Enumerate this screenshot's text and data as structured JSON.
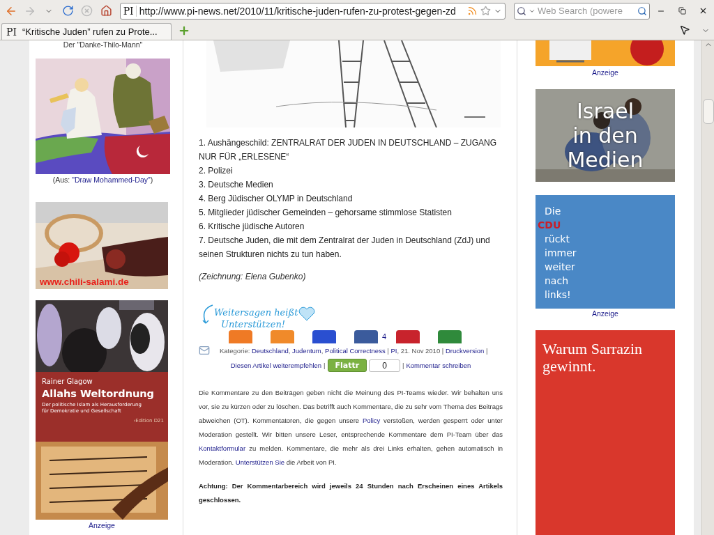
{
  "browser": {
    "url": "http://www.pi-news.net/2010/11/kritische-juden-rufen-zu-protest-gegen-zd",
    "url_favicon": "PI",
    "search_placeholder": "Web Search (powere",
    "tabs": [
      {
        "favicon": "PI",
        "title": "“Kritische Juden” rufen zu Prote...",
        "selected": true
      }
    ]
  },
  "left_column": {
    "top_caption": "Der \"Danke-Thilo-Mann\"",
    "cartoon_caption": {
      "prefix": "(Aus: ",
      "link": "\"Draw Mohammed-Day\"",
      "suffix": ")"
    },
    "salami_ad": "www.chili-salami.de",
    "book": {
      "author": "Rainer Glagow",
      "title": "Allahs Weltordnung",
      "subtitle": "Der politische Islam als Herausforderung für Demokratie und Gesellschaft",
      "publisher": "›Edition D21"
    },
    "ad_label": "Anzeige"
  },
  "article": {
    "list": [
      "1. Aushängeschild: ZENTRALRAT DER JUDEN IN DEUTSCHLAND – ZUGANG NUR FÜR „ERLESENE“",
      "2. Polizei",
      "3. Deutsche Medien",
      "4. Berg Jüdischer OLYMP in Deutschland",
      "5. Mitglieder jüdischer Gemeinden – gehorsame stimmlose Statisten",
      "6. Kritische jüdische Autoren",
      "7. Deutsche Juden, die mit dem Zentralrat der Juden in Deutschland (ZdJ) und seinen Strukturen nichts zu tun haben."
    ],
    "credit": "(Zeichnung: Elena Gubenko)",
    "slogan": [
      "Weitersagen heißt",
      "Unterstützen!"
    ],
    "share_count": "4",
    "meta": [
      {
        "text": "Kategorie: "
      },
      {
        "text": "Deutschland",
        "link": true
      },
      {
        "text": ", "
      },
      {
        "text": "Judentum",
        "link": true
      },
      {
        "text": ", "
      },
      {
        "text": "Political Correctness",
        "link": true
      },
      {
        "text": " | "
      },
      {
        "text": "PI",
        "link": true
      },
      {
        "text": ", 21. Nov 2010 | "
      },
      {
        "text": "Druckversion",
        "link": true
      },
      {
        "text": " |"
      }
    ],
    "recommend": "Diesen Artikel weiterempfehlen",
    "separators": [
      "|",
      "|"
    ],
    "flattr": {
      "label": "Flattr",
      "count": "0"
    },
    "comment_link": "Kommentar schreiben",
    "disclaimer": [
      {
        "text": "Die Kommentare zu den Beiträgen geben nicht die Meinung des PI-Teams wieder. Wir behalten uns vor, sie zu kürzen oder zu löschen. Das betrifft auch Kommentare, die zu sehr vom Thema des Beitrags abweichen (OT). Kommentatoren, die gegen unsere "
      },
      {
        "text": "Policy",
        "link": true
      },
      {
        "text": " verstoßen, werden gesperrt oder unter Moderation gestellt. Wir bitten unsere Leser, entsprechende Kommentare dem PI-Team über das "
      },
      {
        "text": "Kontaktformular",
        "link": true
      },
      {
        "text": " zu melden. Kommentare, die mehr als drei Links erhalten, gehen automatisch in Moderation. "
      },
      {
        "text": "Unterstützen Sie",
        "link": true
      },
      {
        "text": " die Arbeit von PI."
      }
    ],
    "notice": "Achtung: Der Kommentarbereich wird jeweils 24 Stunden nach Erscheinen eines Artikels geschlossen."
  },
  "right_column": {
    "top_ad_label": "Anzeige",
    "israel_ad": [
      "Israel",
      "in den",
      "Medien"
    ],
    "cdu_ad": [
      {
        "text": "Die",
        "highlight": false
      },
      {
        "text": "CDU",
        "highlight": true
      },
      {
        "text": "rückt",
        "highlight": false
      },
      {
        "text": "immer",
        "highlight": false
      },
      {
        "text": "weiter",
        "highlight": false
      },
      {
        "text": "nach",
        "highlight": false
      },
      {
        "text": "links!",
        "highlight": false
      }
    ],
    "cdu_ad_label": "Anzeige",
    "sarrazin_ad": "Warum Sarrazin gewinnt."
  }
}
